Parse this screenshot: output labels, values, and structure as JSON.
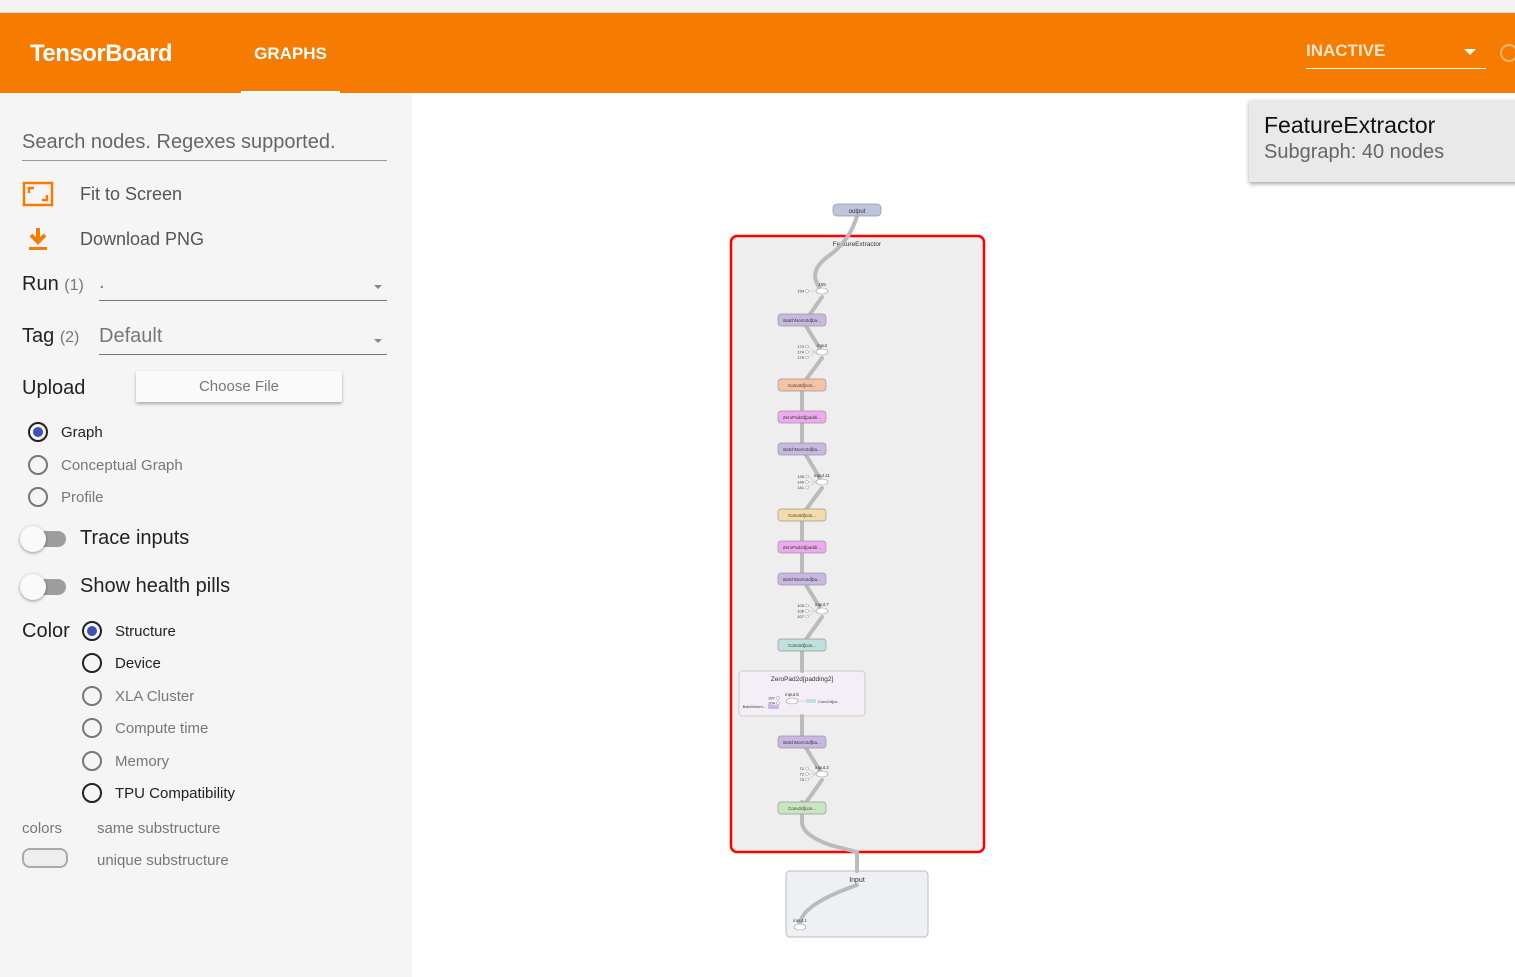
{
  "header": {
    "brand": "TensorBoard",
    "tab": "GRAPHS",
    "run_status": "INACTIVE",
    "accent": "#f57c00"
  },
  "sidebar": {
    "search_placeholder": "Search nodes. Regexes supported.",
    "fit": "Fit to Screen",
    "download": "Download PNG",
    "run": {
      "label": "Run",
      "count": "(1)",
      "value": "."
    },
    "tag": {
      "label": "Tag",
      "count": "(2)",
      "value": "Default"
    },
    "upload": {
      "label": "Upload",
      "button": "Choose File"
    },
    "graph_types": [
      {
        "label": "Graph",
        "selected": true
      },
      {
        "label": "Conceptual Graph"
      },
      {
        "label": "Profile"
      }
    ],
    "trace_inputs": "Trace inputs",
    "health_pills": "Show health pills",
    "color": {
      "label": "Color",
      "options": [
        {
          "label": "Structure",
          "selected": true
        },
        {
          "label": "Device"
        },
        {
          "label": "XLA Cluster"
        },
        {
          "label": "Compute time"
        },
        {
          "label": "Memory"
        },
        {
          "label": "TPU Compatibility"
        }
      ]
    },
    "legend": {
      "colors": "colors",
      "same": "same substructure",
      "unique": "unique substructure"
    }
  },
  "info": {
    "title": "FeatureExtractor",
    "subtitle": "Subgraph: 40 nodes"
  },
  "graph": {
    "output": "output",
    "group": "FeatureExtractor",
    "input_group": "Input",
    "input_node": "input.1",
    "zeropad_group": "ZeroPad2d[padding2]",
    "nodes": [
      {
        "label": "BatchNorm2d[ba...",
        "color": "#c9b8e2"
      },
      {
        "label": "Conv2d[con...",
        "color": "#f6c2a4"
      },
      {
        "label": "ZeroPad2d[paddi...",
        "color": "#eeaaee"
      },
      {
        "label": "BatchNorm2d[ba...",
        "color": "#c9b8e2"
      },
      {
        "label": "Conv2d[con...",
        "color": "#f3dca8"
      },
      {
        "label": "ZeroPad2d[paddi...",
        "color": "#eeaaee"
      },
      {
        "label": "BatchNorm2d[ba...",
        "color": "#c9b8e2"
      },
      {
        "label": "Conv2d[con...",
        "color": "#bfe0dc"
      },
      {
        "label": "BatchNorm2d[ba...",
        "color": "#c9b8e2"
      },
      {
        "label": "Conv2d[con...",
        "color": "#c8e6c0"
      }
    ],
    "ops": [
      {
        "label": "155",
        "consts": [
          "154"
        ]
      },
      {
        "label": "input",
        "consts": [
          "173",
          "174",
          "175"
        ]
      },
      {
        "label": "input.11",
        "consts": [
          "139",
          "140",
          "141"
        ]
      },
      {
        "label": "input.7",
        "consts": [
          "105",
          "106",
          "107"
        ]
      },
      {
        "label": "input.3",
        "consts": [
          "71",
          "72",
          "73"
        ]
      }
    ],
    "zeropad_inner": {
      "op": "input.5",
      "consts": [
        "207",
        "204"
      ],
      "in": "BatchNorm...",
      "out": "Conv2d[co..."
    }
  }
}
